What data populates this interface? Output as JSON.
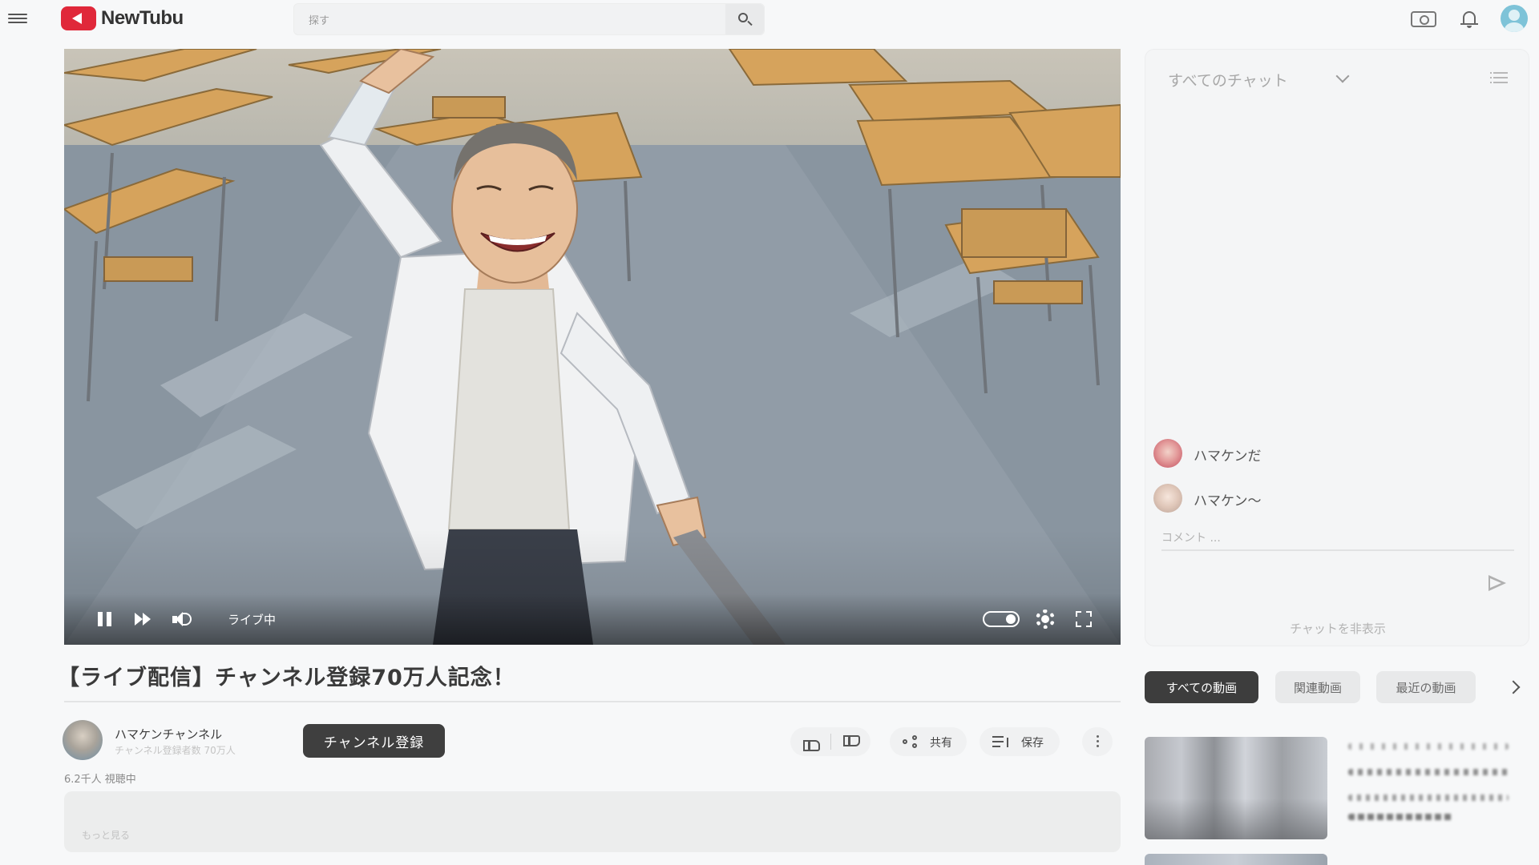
{
  "app": {
    "name": "NewTubu",
    "brand_color": "#e0283a"
  },
  "search": {
    "placeholder": "探す"
  },
  "header_icons": [
    "menu-icon",
    "search-icon",
    "camera-icon",
    "bell-icon",
    "avatar"
  ],
  "player": {
    "status_label": "ライブ中",
    "controls": [
      "pause-icon",
      "next-icon",
      "volume-icon",
      "autoplay-toggle",
      "gear-icon",
      "fullscreen-icon"
    ]
  },
  "video": {
    "title": "【ライブ配信】チャンネル登録70万人記念！",
    "channel_name": "ハマケンチャンネル",
    "subscriber_count": "チャンネル登録者数 70万人",
    "viewers": "6.2千人 視聴中",
    "subscribe_label": "チャンネル登録",
    "share_label": "共有",
    "save_label": "保存",
    "description_more": "もっと見る"
  },
  "chat": {
    "filter_label": "すべてのチャット",
    "messages": [
      {
        "text": "ハマケンだ"
      },
      {
        "text": "ハマケン〜"
      }
    ],
    "input_placeholder": "コメント ...",
    "hide_label": "チャットを非表示"
  },
  "related": {
    "chips": [
      "すべての動画",
      "関連動画",
      "最近の動画"
    ],
    "active_chip": "すべての動画"
  }
}
